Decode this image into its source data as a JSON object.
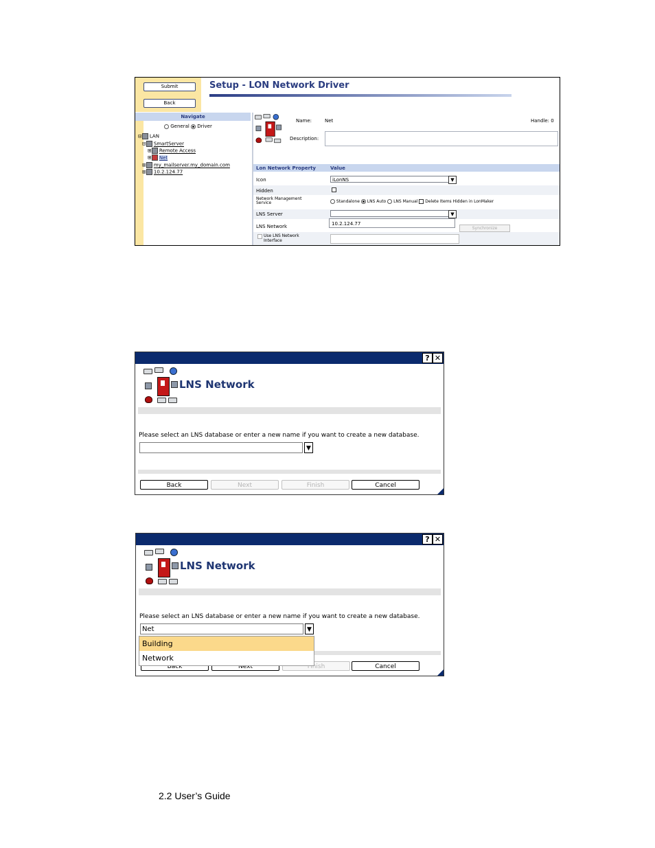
{
  "screenshot1": {
    "buttons": {
      "submit": "Submit",
      "back": "Back"
    },
    "title": "Setup - LON Network Driver",
    "navigate": {
      "header": "Navigate",
      "radio_general": "General",
      "radio_driver": "Driver",
      "selected_radio": "Driver",
      "tree": [
        {
          "label": "LAN",
          "expander": "⊟",
          "link": false
        },
        {
          "label": "SmartServer",
          "expander": "⊟",
          "link": true
        },
        {
          "label": "Remote Access",
          "expander": "⊞",
          "link": true
        },
        {
          "label": "Net",
          "expander": "⊞",
          "link": true,
          "selected": true
        },
        {
          "label": "my_mailserver.my_domain.com",
          "expander": "⊞",
          "link": true
        },
        {
          "label": "10.2.124.77",
          "expander": "⊞",
          "link": true
        }
      ]
    },
    "properties": {
      "name_label": "Name:",
      "name_value": "Net",
      "handle": "Handle: 0",
      "description_label": "Description:",
      "header_property": "Lon Network Property",
      "header_value": "Value",
      "rows": {
        "icon_label": "Icon",
        "icon_value": "iLonNS",
        "hidden_label": "Hidden",
        "nms_label_1": "Network Management",
        "nms_label_2": "Service",
        "nms_standalone": "Standalone",
        "nms_lns_auto": "LNS Auto",
        "nms_lns_manual": "LNS Manual",
        "nms_delete_hidden": "Delete Items Hidden in LonMaker",
        "nms_selected": "LNS Auto",
        "lns_server_label": "LNS Server",
        "lns_server_popup": "10.2.124.77",
        "lns_network_label": "LNS Network",
        "synchronize": "Synchronize",
        "use_lns_label_1": "Use LNS Network",
        "use_lns_label_2": "Interface"
      }
    }
  },
  "dialog1": {
    "title": "LNS Network",
    "help_button": "?",
    "close_button": "✕",
    "prompt": "Please select an LNS database or enter a new name if you want to create a new database.",
    "combo_value": "",
    "buttons": {
      "back": "Back",
      "next": "Next",
      "finish": "Finish",
      "cancel": "Cancel"
    }
  },
  "dialog2": {
    "title": "LNS Network",
    "help_button": "?",
    "close_button": "✕",
    "prompt": "Please select an LNS database or enter a new name if you want to create a new database.",
    "combo_value": "Net",
    "dropdown_options": [
      "Building",
      "Network"
    ],
    "highlighted_option": "Building",
    "buttons": {
      "back": "Back",
      "next": "Next",
      "finish": "Finish",
      "cancel": "Cancel"
    }
  },
  "footer": "2.2 User’s Guide",
  "colors": {
    "accent_dark_blue": "#0b2a6d",
    "title_blue": "#2a3c80",
    "panel_yellow": "#fbe6a3",
    "highlight": "#fbd98b"
  }
}
